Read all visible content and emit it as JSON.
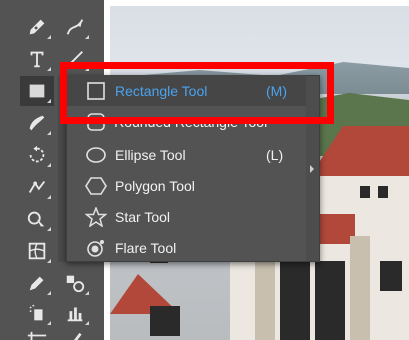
{
  "toolbar": {
    "tools_left": [
      {
        "name": "pen-tool-icon"
      },
      {
        "name": "type-tool-icon"
      },
      {
        "name": "rectangle-tool-icon",
        "active": true
      },
      {
        "name": "shaper-tool-icon"
      },
      {
        "name": "rotate-tool-icon"
      },
      {
        "name": "puppet-warp-tool-icon"
      },
      {
        "name": "shape-builder-tool-icon"
      },
      {
        "name": "mesh-tool-icon"
      },
      {
        "name": "eyedropper-tool-icon"
      },
      {
        "name": "symbol-sprayer-tool-icon"
      },
      {
        "name": "artboard-tool-icon"
      }
    ],
    "tools_right": [
      {
        "name": "curvature-tool-icon"
      },
      {
        "name": "line-tool-icon"
      },
      {
        "name": "blend-tool-icon"
      },
      {
        "name": "column-graph-tool-icon"
      },
      {
        "name": "slice-tool-icon"
      }
    ]
  },
  "flyout": {
    "items": [
      {
        "label": "Rectangle Tool",
        "shortcut": "(M)",
        "icon": "rectangle-icon",
        "selected": true
      },
      {
        "label": "Rounded Rectangle Tool",
        "shortcut": "",
        "icon": "rounded-rectangle-icon",
        "selected": false
      },
      {
        "label": "Ellipse Tool",
        "shortcut": "(L)",
        "icon": "ellipse-icon",
        "selected": false
      },
      {
        "label": "Polygon Tool",
        "shortcut": "",
        "icon": "polygon-icon",
        "selected": false
      },
      {
        "label": "Star Tool",
        "shortcut": "",
        "icon": "star-icon",
        "selected": false
      },
      {
        "label": "Flare Tool",
        "shortcut": "",
        "icon": "flare-icon",
        "selected": false
      }
    ]
  },
  "colors": {
    "toolbar_bg": "#535353",
    "selected_text": "#4aa3f0",
    "highlight": "#ff0000"
  }
}
